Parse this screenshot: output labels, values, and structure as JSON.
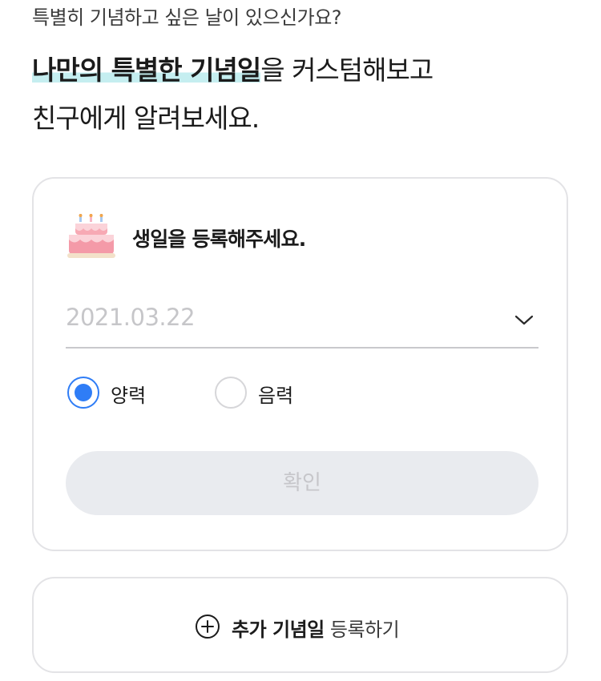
{
  "intro": {
    "subtitle": "특별히 기념하고 싶은 날이 있으신가요?",
    "headline_highlight": "나만의 특별한 기념일",
    "headline_rest": "을 커스텀해보고",
    "headline_line2": "친구에게 알려보세요."
  },
  "birthday_card": {
    "icon": "birthday-cake-icon",
    "title": "생일을 등록해주세요.",
    "date_placeholder": "2021.03.22",
    "calendar_options": [
      {
        "label": "양력",
        "selected": true
      },
      {
        "label": "음력",
        "selected": false
      }
    ],
    "confirm_label": "확인"
  },
  "add_anniversary": {
    "icon": "plus-circle-icon",
    "bold_label": "추가 기념일",
    "label": "등록하기"
  },
  "colors": {
    "accent": "#2f7df6",
    "highlight": "#c5eef0",
    "disabled_button": "#e9ebef"
  }
}
